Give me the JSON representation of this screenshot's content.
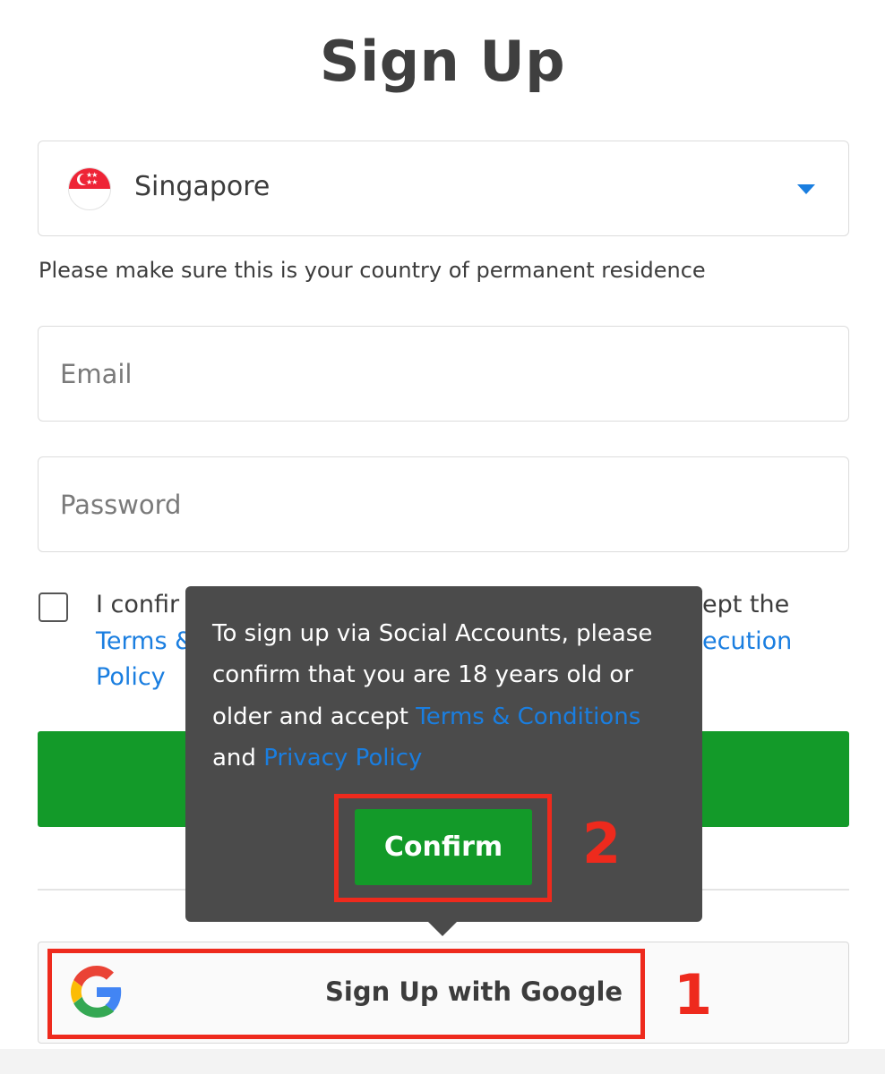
{
  "title": "Sign Up",
  "country": {
    "selected": "Singapore",
    "hint": "Please make sure this is your country of permanent residence"
  },
  "email": {
    "placeholder": "Email"
  },
  "password": {
    "placeholder": "Password"
  },
  "terms": {
    "line1_start": "I confir",
    "line1_end": "ept the",
    "line2_start": "Terms &",
    "line2_end": "ecution",
    "line3": "Policy"
  },
  "tooltip": {
    "line1": "To sign up via Social Accounts, please",
    "line2": "confirm that you are 18 years old or",
    "line3_prefix": "older and accept ",
    "terms_link": "Terms & Conditions",
    "line4_prefix": "and ",
    "privacy_link": "Privacy Policy",
    "confirm_label": "Confirm"
  },
  "google": {
    "label": "Sign Up with Google"
  },
  "annotations": {
    "step1": "1",
    "step2": "2"
  },
  "colors": {
    "accent_blue": "#1a7ee0",
    "button_green": "#139a29",
    "tooltip_bg": "#4b4b4b",
    "annotation_red": "#ee2a1d"
  }
}
